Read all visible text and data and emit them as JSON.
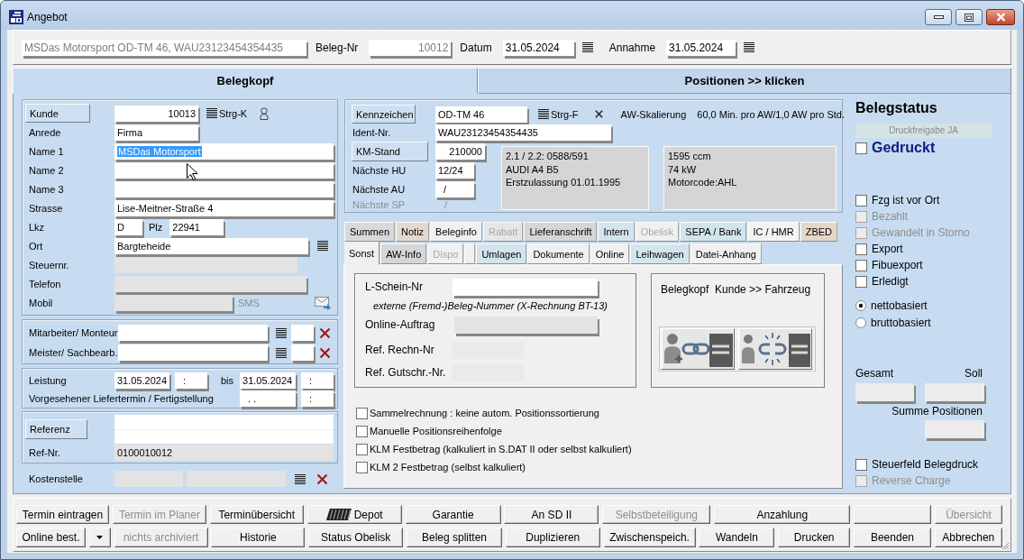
{
  "window": {
    "title": "Angebot"
  },
  "header": {
    "summary": {
      "value": "MSDas Motorsport OD-TM 46, WAU23123454354435",
      "disabled": true
    },
    "fields": [
      {
        "label": "Beleg-Nr",
        "value": "10012",
        "disabled": true
      },
      {
        "label": "Datum",
        "value": "31.05.2024",
        "disabled": false,
        "picker": true
      },
      {
        "label": "Annahme",
        "value": "31.05.2024",
        "disabled": false,
        "picker": true
      }
    ]
  },
  "main_tabs": [
    {
      "label": "Belegkopf",
      "selected": true
    },
    {
      "label": "Positionen >> klicken",
      "selected": false
    }
  ],
  "customer": {
    "number": {
      "button": "Kunde",
      "value": "10013",
      "shortcut": "Strg-K"
    },
    "salutation": {
      "label": "Anrede",
      "value": "Firma"
    },
    "names": [
      {
        "label": "Name 1",
        "value": "MSDas Motorsport",
        "text_selected": true
      },
      {
        "label": "Name 2"
      },
      {
        "label": "Name 3"
      }
    ],
    "street": {
      "label": "Strasse",
      "value": "Lise-Meitner-Straße 4"
    },
    "country": {
      "label": "Lkz",
      "value": "D"
    },
    "postcode": {
      "label": "Plz",
      "value": "22941"
    },
    "city": {
      "label": "Ort",
      "value": "Bargteheide"
    },
    "tax_number": {
      "label": "Steuernr.",
      "disabled": true
    },
    "phone": {
      "label": "Telefon",
      "disabled": true
    },
    "mobile": {
      "label": "Mobil",
      "disabled": true
    },
    "sms": {
      "label": "SMS",
      "disabled": true
    }
  },
  "staff": [
    {
      "label": "Mitarbeiter/ Monteur"
    },
    {
      "label": "Meister/ Sachbearb."
    }
  ],
  "service": {
    "label": "Leistung",
    "from_date": "31.05.2024",
    "from_time": ":",
    "to_label": "bis",
    "to_date": "31.05.2024",
    "to_time": ":"
  },
  "delivery": {
    "label": "Vorgesehener Liefertermin / Fertigstellung",
    "date": ". .",
    "time": ":"
  },
  "reference": {
    "button": "Referenz",
    "number_label": "Ref-Nr.",
    "number": "0100010012"
  },
  "cost_center": {
    "label": "Kostenstelle"
  },
  "vehicle": {
    "plate": {
      "button": "Kennzeichen",
      "value": "OD-TM 46",
      "shortcut": "Strg-F"
    },
    "aw_label": "AW-Skalierung",
    "aw_value": "60,0 Min. pro AW/1,0 AW pro Std.",
    "vin": {
      "label": "Ident-Nr.",
      "value": "WAU23123454354435"
    },
    "mileage": {
      "button": "KM-Stand",
      "value": "210000"
    },
    "next_hu": {
      "label": "Nächste HU",
      "value": "12/24"
    },
    "next_au": {
      "label": "Nächste AU",
      "value": "/"
    },
    "next_sp": {
      "label": "Nächste SP",
      "value": "/",
      "disabled": true
    },
    "details": [
      "2.1 / 2.2: 0588/591",
      "AUDI A4 B5",
      "Erstzulassung 01.01.1995"
    ],
    "engine": [
      "1595 ccm",
      "74 kW",
      "Motorcode:AHL"
    ]
  },
  "tab_rows": [
    {
      "tabs": [
        {
          "label": "Summen",
          "selected": false,
          "disabled": false,
          "color": "#d9d9d9"
        },
        {
          "label": "Notiz",
          "selected": false,
          "disabled": false,
          "color": "#e3d9cf"
        },
        {
          "label": "Beleginfo",
          "selected": false,
          "disabled": false,
          "color": "#f0f0f0"
        },
        {
          "label": "Rabatt",
          "selected": false,
          "disabled": true,
          "color": "#e6e6e6"
        },
        {
          "label": "Lieferanschrift",
          "selected": false,
          "disabled": false,
          "color": "#d6d6d6"
        },
        {
          "label": "Intern",
          "selected": false,
          "disabled": false,
          "color": "#d3e5ec"
        },
        {
          "label": "Obelisk",
          "selected": false,
          "disabled": true,
          "color": "#f0f0f0"
        },
        {
          "label": "SEPA / Bank",
          "selected": false,
          "disabled": false,
          "color": "#d3e5ec"
        },
        {
          "label": "IC / HMR",
          "selected": false,
          "disabled": false,
          "color": "#f3f3f3"
        },
        {
          "label": "ZBED",
          "selected": false,
          "disabled": false,
          "color": "#e6d6c8"
        }
      ]
    },
    {
      "tabs": [
        {
          "label": "Sonst",
          "selected": true,
          "disabled": false,
          "color": "#f0f0f0"
        },
        {
          "label": "AW-Info",
          "selected": false,
          "disabled": false,
          "color": "#d6d6d6"
        },
        {
          "label": "Dispo",
          "selected": false,
          "disabled": true,
          "color": "#f0f0f0"
        },
        {
          "selected": false,
          "color": "#f0f0f0"
        },
        {
          "label": "Umlagen",
          "selected": false,
          "disabled": false,
          "color": "#d3e5ec"
        },
        {
          "label": "Dokumente",
          "selected": false,
          "disabled": false,
          "color": "#f0f0f0"
        },
        {
          "label": "Online",
          "selected": false,
          "disabled": false,
          "color": "#f0f0f0"
        },
        {
          "label": "Leihwagen",
          "selected": false,
          "disabled": false,
          "color": "#d3e5ec"
        },
        {
          "label": "Datei-Anhang",
          "selected": false,
          "disabled": false,
          "color": "#f0f0f0"
        }
      ]
    }
  ],
  "sonst": {
    "delivery_note": {
      "label": "L-Schein-Nr",
      "disabled": false
    },
    "hint": "externe (Fremd-)Beleg-Nummer (X-Rechnung BT-13)",
    "online_order": {
      "label": "Online-Auftrag",
      "disabled": true
    },
    "invoice_ref": {
      "label": "Ref. Rechn-Nr",
      "disabled": true
    },
    "credit_ref": {
      "label": "Ref. Gutschr.-Nr.",
      "disabled": true
    },
    "link_title": "Belegkopf  Kunde >> Fahrzeug",
    "options": [
      {
        "label": "Sammelrechnung : keine autom. Positionssortierung",
        "checked": false
      },
      {
        "label": "Manuelle Positionsreihenfolge",
        "checked": false
      },
      {
        "label": "KLM Festbetrag (kalkuliert in S.DAT II oder selbst kalkuliert)",
        "checked": false
      },
      {
        "label": "KLM 2 Festbetrag (selbst kalkuliert)",
        "checked": false
      }
    ]
  },
  "status": {
    "title": "Belegstatus",
    "release": "Druckfreigabe JA",
    "printed": {
      "label": "Gedruckt",
      "checked": false
    },
    "flags": [
      {
        "label": "Fzg ist vor Ort",
        "checked": false,
        "disabled": false
      },
      {
        "label": "Bezahlt",
        "checked": false,
        "disabled": true
      },
      {
        "label": "Gewandelt in Storno",
        "checked": false,
        "disabled": true
      },
      {
        "label": "Export",
        "checked": false,
        "disabled": false
      },
      {
        "label": "Fibuexport",
        "checked": false,
        "disabled": false
      },
      {
        "label": "Erledigt",
        "checked": false,
        "disabled": false
      }
    ],
    "basis": [
      {
        "label": "nettobasiert",
        "selected": true
      },
      {
        "label": "bruttobasiert",
        "selected": false
      }
    ],
    "total_label": "Gesamt",
    "target_label": "Soll",
    "sum_label": "Summe Positionen",
    "print_flags": [
      {
        "label": "Steuerfeld Belegdruck",
        "checked": false,
        "disabled": false
      },
      {
        "label": "Reverse Charge",
        "checked": false,
        "disabled": true
      }
    ]
  },
  "button_rows": [
    {
      "buttons": [
        {
          "kind": "text",
          "label": "Termin eintragen",
          "disabled": false
        },
        {
          "kind": "text",
          "label": "Termin im Planer",
          "disabled": true
        },
        {
          "kind": "text",
          "label": "Terminübersicht",
          "disabled": false
        },
        {
          "kind": "icon-text",
          "label": "Depot",
          "disabled": false
        },
        {
          "kind": "text",
          "label": "Garantie",
          "disabled": false
        },
        {
          "kind": "text",
          "label": "An SD II",
          "disabled": false
        },
        {
          "kind": "text",
          "label": "Selbstbeteiligung",
          "disabled": true
        },
        {
          "kind": "text",
          "label": "Anzahlung",
          "disabled": false
        },
        {
          "kind": "blank"
        },
        {
          "kind": "text",
          "label": "Übersicht",
          "disabled": true
        }
      ]
    },
    {
      "buttons": [
        {
          "kind": "text",
          "label": "Online best.",
          "disabled": false
        },
        {
          "kind": "arrow",
          "disabled": false
        },
        {
          "kind": "text",
          "label": "nichts archiviert",
          "disabled": true
        },
        {
          "kind": "text",
          "label": "Historie",
          "disabled": false
        },
        {
          "kind": "text",
          "label": "Status Obelisk",
          "disabled": false
        },
        {
          "kind": "text",
          "label": "Beleg splitten",
          "disabled": false
        },
        {
          "kind": "text",
          "label": "Duplizieren",
          "disabled": false
        },
        {
          "kind": "text",
          "label": "Zwischenspeich.",
          "disabled": false
        },
        {
          "kind": "text",
          "label": "Wandeln",
          "disabled": false
        },
        {
          "kind": "text",
          "label": "Drucken",
          "disabled": false
        },
        {
          "kind": "text",
          "label": "Beenden",
          "disabled": false
        },
        {
          "kind": "text",
          "label": "Abbrechen",
          "disabled": false
        }
      ]
    }
  ]
}
